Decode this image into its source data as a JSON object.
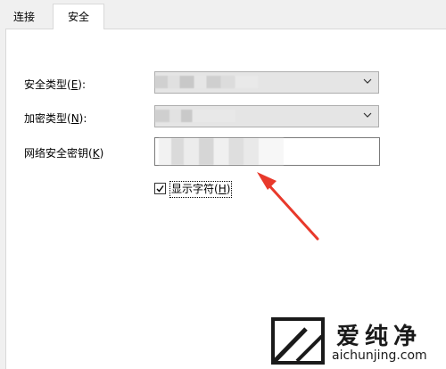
{
  "tabs": [
    {
      "label": "连接",
      "active": false
    },
    {
      "label": "安全",
      "active": true
    }
  ],
  "form": {
    "security_type": {
      "label_prefix": "安全类型(",
      "accel": "E",
      "label_suffix": "):"
    },
    "encryption_type": {
      "label_prefix": "加密类型(",
      "accel": "N",
      "label_suffix": "):"
    },
    "network_key": {
      "label_prefix": "网络安全密钥(",
      "accel": "K",
      "label_suffix": ")"
    },
    "show_characters": {
      "label_prefix": "显示字符(",
      "accel": "H",
      "label_suffix": ")",
      "checked": true
    }
  },
  "watermark": {
    "title": "爱纯净",
    "url": "aichunjing.com"
  },
  "colors": {
    "arrow": "#e8392b",
    "watermark": "#1a1a1a"
  }
}
